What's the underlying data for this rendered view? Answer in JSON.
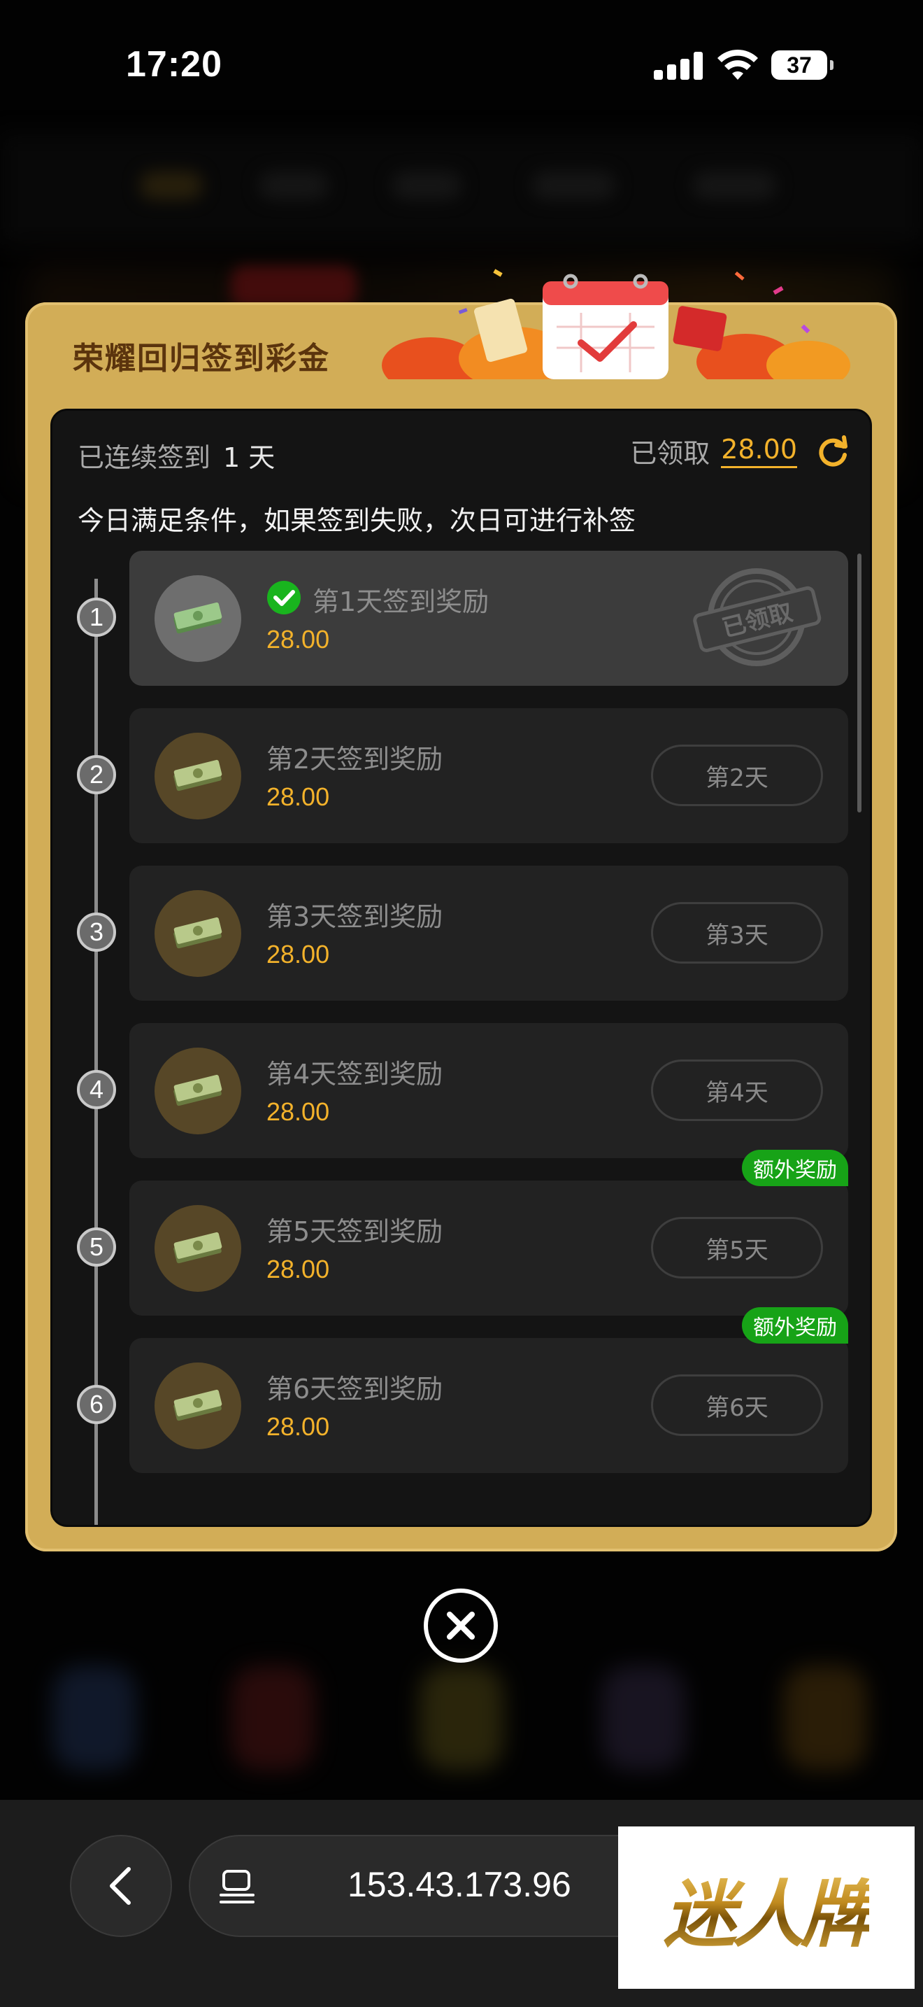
{
  "status_bar": {
    "time": "17:20",
    "battery": "37"
  },
  "modal": {
    "title": "荣耀回归签到彩金",
    "streak_label": "已连续签到",
    "streak_value": "1 天",
    "claimed_label": "已领取",
    "claimed_amount": "28.00",
    "note": "今日满足条件，如果签到失败，次日可进行补签",
    "days": [
      {
        "step": "1",
        "title": "第1天签到奖励",
        "reward": "28.00",
        "status": "claimed",
        "stamp": "已领取"
      },
      {
        "step": "2",
        "title": "第2天签到奖励",
        "reward": "28.00",
        "button": "第2天"
      },
      {
        "step": "3",
        "title": "第3天签到奖励",
        "reward": "28.00",
        "button": "第3天"
      },
      {
        "step": "4",
        "title": "第4天签到奖励",
        "reward": "28.00",
        "button": "第4天"
      },
      {
        "step": "5",
        "title": "第5天签到奖励",
        "reward": "28.00",
        "button": "第5天",
        "badge": "额外奖励"
      },
      {
        "step": "6",
        "title": "第6天签到奖励",
        "reward": "28.00",
        "button": "第6天",
        "badge": "额外奖励"
      }
    ]
  },
  "browser": {
    "url": "153.43.173.96"
  },
  "watermark": "迷人牌",
  "colors": {
    "gold": "#d2ad57",
    "reward": "#f3b22b",
    "badge_green": "#17a317",
    "title_brown": "#5b340d"
  },
  "icons": [
    "signal-icon",
    "wifi-icon",
    "refresh-icon",
    "check-icon",
    "money-icon",
    "claimed-stamp",
    "close-icon",
    "chevron-left-icon",
    "tabs-icon"
  ]
}
